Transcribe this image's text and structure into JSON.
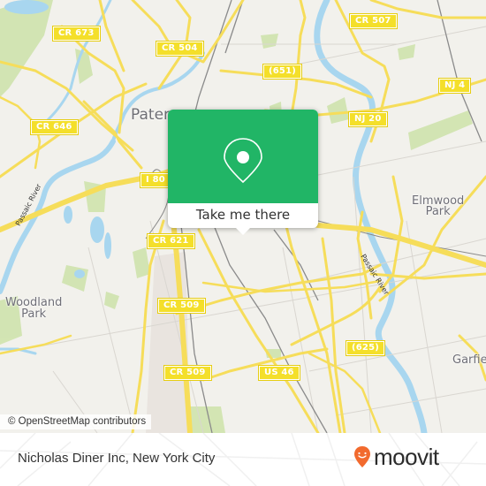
{
  "map": {
    "shields": [
      {
        "id": "cr-673",
        "label": "CR 673"
      },
      {
        "id": "cr-504",
        "label": "CR 504"
      },
      {
        "id": "cr-507",
        "label": "CR 507"
      },
      {
        "id": "rt-651",
        "label": "(651)"
      },
      {
        "id": "nj-4",
        "label": "NJ 4"
      },
      {
        "id": "nj-20",
        "label": "NJ 20"
      },
      {
        "id": "cr-646",
        "label": "CR 646"
      },
      {
        "id": "i-80",
        "label": "I 80"
      },
      {
        "id": "cr-621",
        "label": "CR 621"
      },
      {
        "id": "cr-509a",
        "label": "CR 509"
      },
      {
        "id": "cr-509b",
        "label": "CR 509"
      },
      {
        "id": "us-46",
        "label": "US 46"
      },
      {
        "id": "rt-625",
        "label": "(625)"
      }
    ],
    "places": {
      "paterson": "Paterson",
      "elmwood_park": "Elmwood\nPark",
      "woodland_park": "Woodland\nPark",
      "garfield": "Garfield"
    },
    "rivers": {
      "passaic_west": "Passaic River",
      "passaic_east": "Passaic River"
    },
    "colors": {
      "land": "#f2f1ec",
      "road": "#f6dd5a",
      "water": "#a8d6ef",
      "park": "#cfe3ad",
      "popup_green": "#21b566"
    }
  },
  "popup": {
    "icon": "map-pin-icon",
    "button_label": "Take me there"
  },
  "attribution": "© OpenStreetMap contributors",
  "footer": {
    "place_name": "Nicholas Diner Inc, New York City",
    "logo_text": "moovit",
    "logo_color": "#f26a2e"
  }
}
